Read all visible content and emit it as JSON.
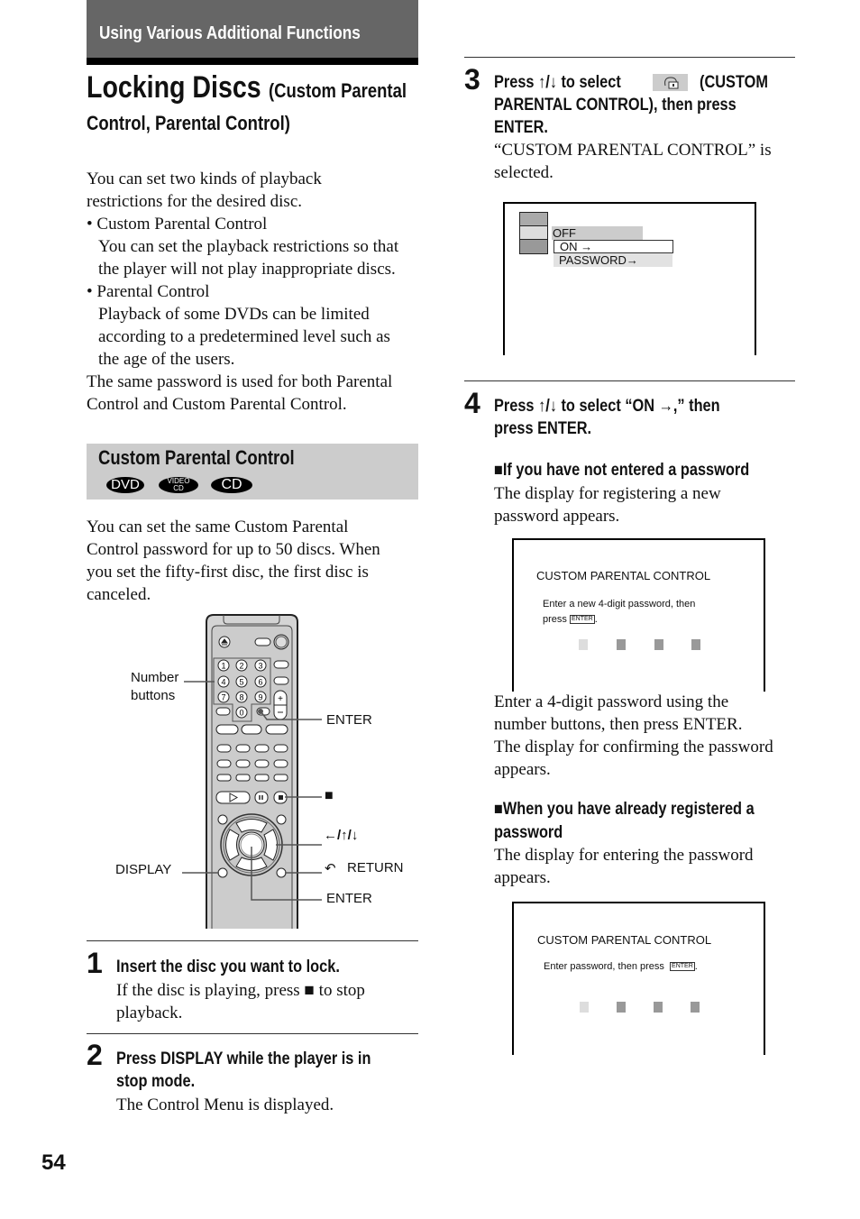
{
  "header": {
    "section": "Using Various Additional Functions",
    "title_main": "Locking Discs",
    "title_sub_line1": "(Custom Parental",
    "title_sub_line2": "Control, Parental Control)"
  },
  "intro": {
    "lines": [
      "You can set two kinds of playback",
      "restrictions for the desired disc."
    ],
    "bullets": [
      {
        "label": "• Custom Parental Control",
        "detail": [
          "You can set the playback restrictions so that",
          "the player will not play inappropriate discs."
        ]
      },
      {
        "label": "• Parental Control",
        "detail": [
          "Playback of some DVDs can be limited",
          "according to a predetermined level such as",
          "the age of the users."
        ]
      }
    ],
    "closing": [
      "The same password is used for both Parental",
      "Control and Custom Parental Control."
    ]
  },
  "custom_parental_control": {
    "heading": "Custom Parental Control",
    "disc_badges": [
      {
        "label": "DVD",
        "icon": "dvd-badge"
      },
      {
        "label": "VIDEO CD",
        "line1": "VIDEO",
        "line2": "CD",
        "icon": "vcd-badge"
      },
      {
        "label": "CD",
        "icon": "cd-badge"
      }
    ],
    "description": [
      "You can set the same Custom Parental",
      "Control password for up to 50 discs. When",
      "you set the fifty-first disc, the first disc is",
      "canceled."
    ]
  },
  "remote_diagram": {
    "callouts": {
      "number_buttons_1": "Number",
      "number_buttons_2": "buttons",
      "enter_top": "ENTER",
      "stop": "■",
      "arrows": "←/↑/↓",
      "display": "DISPLAY",
      "return": "RETURN",
      "return_icon": "↶",
      "enter_bottom": "ENTER"
    },
    "number_keys": [
      "1",
      "2",
      "3",
      "4",
      "5",
      "6",
      "7",
      "8",
      "9",
      "0"
    ]
  },
  "steps": [
    {
      "number": "1",
      "heading": [
        "Insert the disc you want to lock."
      ],
      "body": [
        "If the disc is playing, press ■ to stop",
        "playback."
      ]
    },
    {
      "number": "2",
      "heading": [
        "Press DISPLAY while the player is in",
        "stop mode."
      ],
      "body": [
        "The Control Menu is displayed."
      ]
    },
    {
      "number": "3",
      "heading": [
        "Press ↑/↓ to select",
        "(CUSTOM",
        "PARENTAL CONTROL), then press",
        "ENTER."
      ],
      "body": [
        "“CUSTOM PARENTAL CONTROL” is",
        "selected."
      ],
      "osd": {
        "options": [
          "OFF",
          "ON →",
          "PASSWORD→"
        ],
        "selected": "ON →"
      }
    },
    {
      "number": "4",
      "heading": [
        "Press ↑/↓ to select “ON →,” then",
        "press ENTER."
      ],
      "case_new": {
        "heading": "■If you have not entered a password",
        "body": [
          "The display for registering a new",
          "password appears."
        ],
        "osd": {
          "title": "CUSTOM PARENTAL CONTROL",
          "prompt_line1": "Enter a new 4-digit password, then",
          "prompt_line2": "press",
          "enter_key": "ENTER",
          "digits_entered": 0,
          "digits_total": 4
        },
        "after": [
          "Enter a 4-digit password using the",
          "number buttons, then press ENTER.",
          "The display for confirming the password",
          "appears."
        ]
      },
      "case_existing": {
        "heading_line1": "■When you have already registered a",
        "heading_line2": "password",
        "body": [
          "The display for entering the password",
          "appears."
        ],
        "osd": {
          "title": "CUSTOM PARENTAL CONTROL",
          "prompt": "Enter password, then press",
          "enter_key": "ENTER",
          "digits_entered": 0,
          "digits_total": 4
        }
      }
    }
  ],
  "footer": {
    "page_number": "54"
  }
}
